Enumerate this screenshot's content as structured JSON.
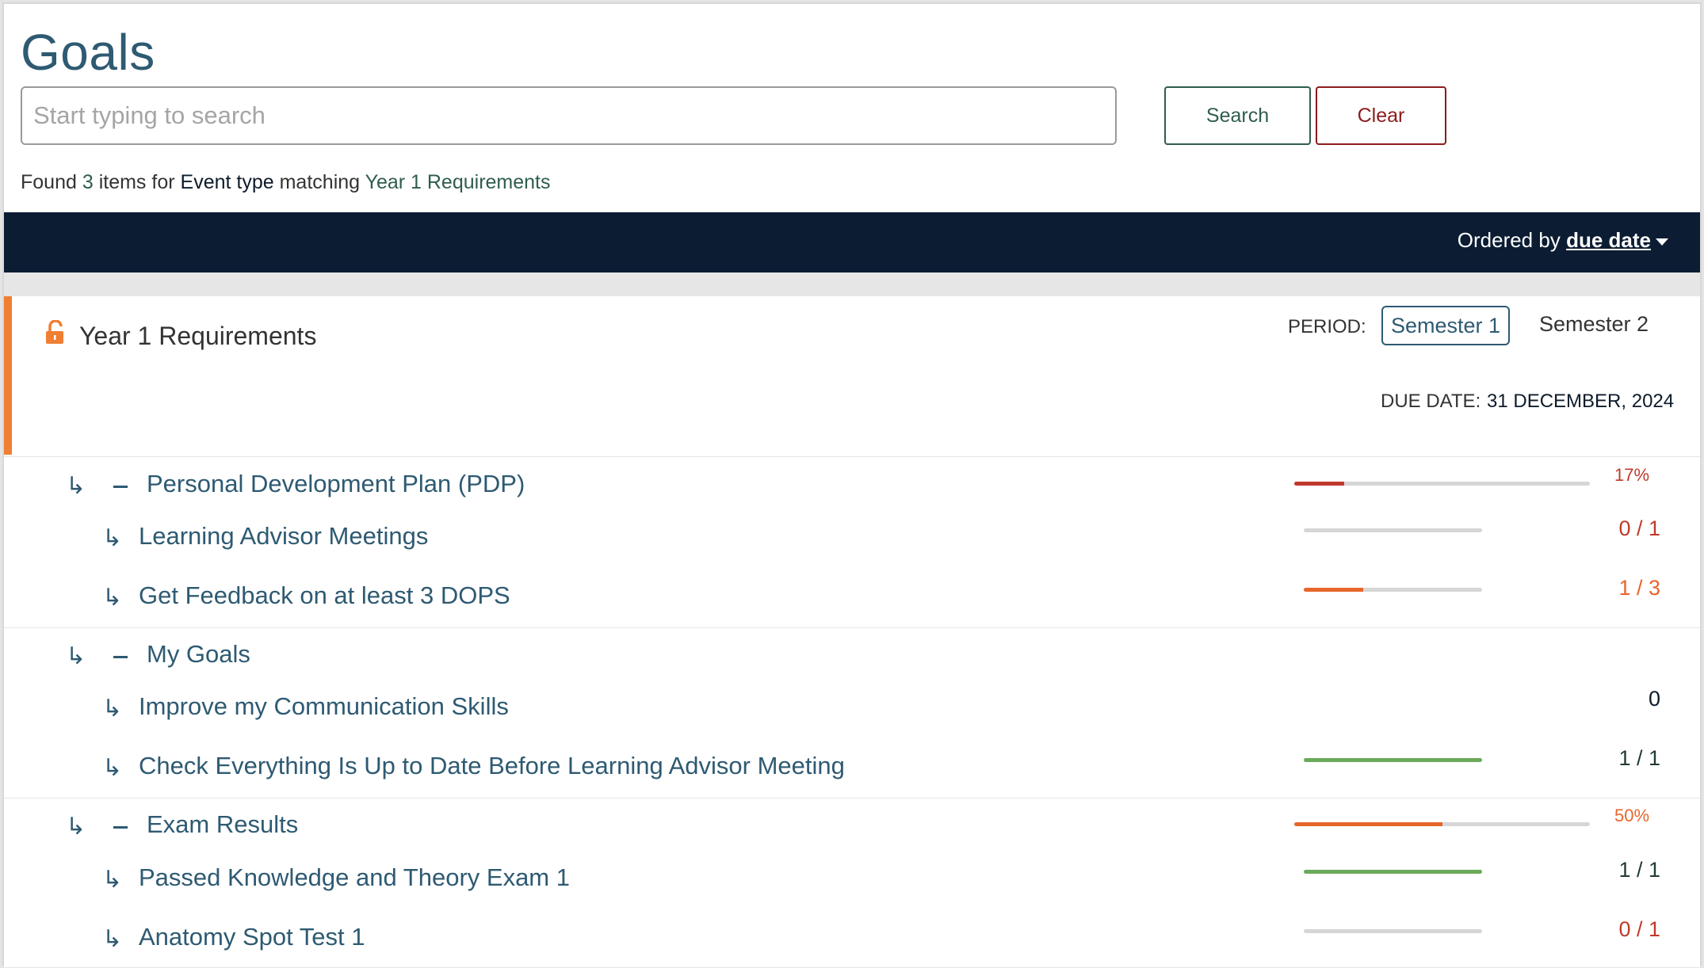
{
  "header": {
    "title": "Goals",
    "search_placeholder": "Start typing to search",
    "search_label": "Search",
    "clear_label": "Clear",
    "result": {
      "prefix": "Found",
      "count": "3",
      "middle": "items for",
      "field": "Event type",
      "matching": "matching",
      "term": "Year 1 Requirements"
    }
  },
  "toolbar": {
    "ordered_by_label": "Ordered by",
    "sort_field": "due date"
  },
  "section": {
    "title": "Year 1 Requirements",
    "period_label": "PERIOD:",
    "periods": [
      "Semester 1",
      "Semester 2"
    ],
    "due_date_label": "DUE DATE:",
    "due_date": "31 DECEMBER, 2024",
    "icon": "unlocked-padlock-icon"
  },
  "groups": [
    {
      "title": "Personal Development Plan (PDP)",
      "progress_percent": 17,
      "progress_label": "17%",
      "items": [
        {
          "title": "Learning Advisor Meetings",
          "completed": 0,
          "total": 1,
          "label": "0 / 1"
        },
        {
          "title": "Get Feedback on at least 3 DOPS",
          "completed": 1,
          "total": 3,
          "label": "1 / 3"
        }
      ]
    },
    {
      "title": "My Goals",
      "progress_percent": null,
      "progress_label": "",
      "items": [
        {
          "title": "Improve my Communication Skills",
          "completed": null,
          "total": null,
          "label": "0"
        },
        {
          "title": "Check Everything Is Up to Date Before Learning Advisor Meeting",
          "completed": 1,
          "total": 1,
          "label": "1 / 1"
        }
      ]
    },
    {
      "title": "Exam Results",
      "progress_percent": 50,
      "progress_label": "50%",
      "items": [
        {
          "title": "Passed Knowledge and Theory Exam 1",
          "completed": 1,
          "total": 1,
          "label": "1 / 1"
        },
        {
          "title": "Anatomy Spot Test 1",
          "completed": 0,
          "total": 1,
          "label": "0 / 1"
        }
      ]
    }
  ],
  "colors": {
    "brand": "#2e5a72",
    "accent": "#ef7f33",
    "nav_bar": "#0b1c33",
    "low": "#c0392b",
    "mid": "#e8652a",
    "complete": "#6aaa5a"
  }
}
